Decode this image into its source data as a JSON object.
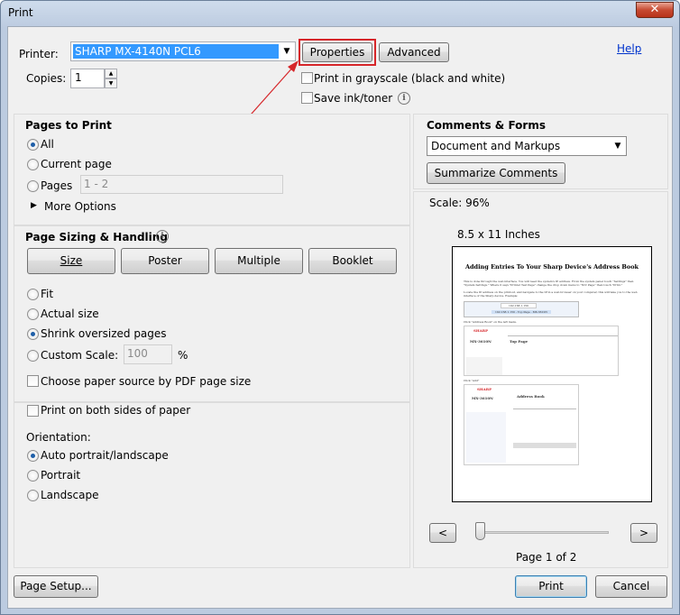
{
  "window": {
    "title": "Print",
    "close_glyph": "✕"
  },
  "printer": {
    "label": "Printer:",
    "value": "SHARP MX-4140N PCL6",
    "properties_label": "Properties",
    "advanced_label": "Advanced",
    "help_label": "Help"
  },
  "copies": {
    "label": "Copies:",
    "value": "1"
  },
  "options": {
    "grayscale": "Print in grayscale (black and white)",
    "save_ink": "Save ink/toner"
  },
  "pages_to_print": {
    "title": "Pages to Print",
    "all": "All",
    "current": "Current page",
    "pages": "Pages",
    "pages_value": "1 - 2",
    "more": "More Options"
  },
  "sizing": {
    "title": "Page Sizing & Handling",
    "tabs": [
      "Size",
      "Poster",
      "Multiple",
      "Booklet"
    ],
    "fit": "Fit",
    "actual": "Actual size",
    "shrink": "Shrink oversized pages",
    "custom": "Custom Scale:",
    "custom_value": "100",
    "percent": "%",
    "pdf_source": "Choose paper source by PDF page size"
  },
  "duplex": {
    "label": "Print on both sides of paper"
  },
  "orientation": {
    "title": "Orientation:",
    "auto": "Auto portrait/landscape",
    "portrait": "Portrait",
    "landscape": "Landscape"
  },
  "comments": {
    "title": "Comments & Forms",
    "value": "Document and Markups",
    "summarize": "Summarize Comments"
  },
  "preview": {
    "scale": "Scale:  96%",
    "paper_size": "8.5 x 11 Inches",
    "page_info": "Page 1 of 2",
    "prev": "<",
    "next": ">",
    "doc": {
      "heading": "Adding Entries To Your Sharp Device's Address Book",
      "para1": "This is done through the web interface. You will need the system's IP address. From the system panel touch \"Settings\" then \"System Settings.\" Where it says \"Printer Test Page\" change the drop down menu to \"NIC Page\" then touch \"Print.\"",
      "para2": "Locate the IP address on the printout, and navigate to the IP in a web browser on your computer, this will take you to the web interface of the Sharp device. Example:",
      "url": "192.168.1.150",
      "url_tab": "192.168.1.150 - Top Page - MX-3610N",
      "step1": "Click \"Address Book\" on the left menu.",
      "step2": "Click \"Add\"",
      "sharp": "SHARP",
      "model": "MX-3610N",
      "top_page": "Top Page",
      "address_book": "Address Book"
    }
  },
  "footer": {
    "page_setup": "Page Setup...",
    "print": "Print",
    "cancel": "Cancel"
  },
  "colors": {
    "highlight": "#3399ff",
    "annotation": "#d6262a"
  }
}
